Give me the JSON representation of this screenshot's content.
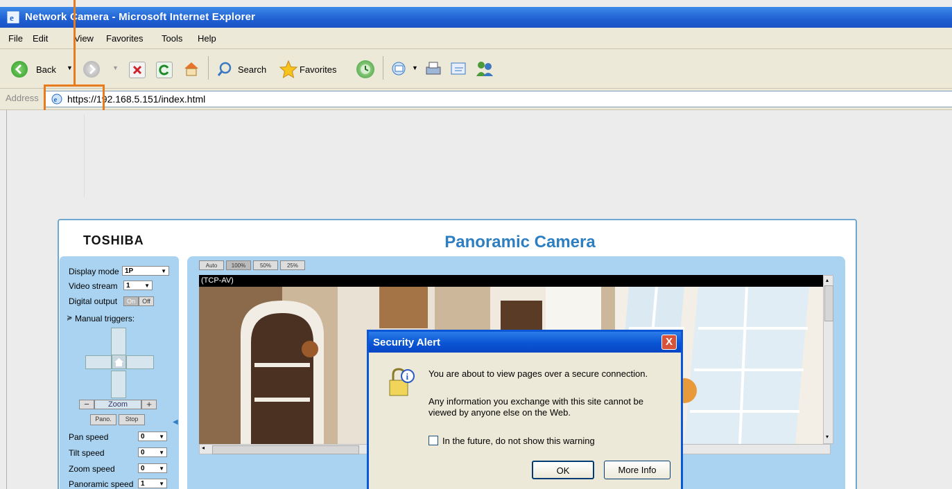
{
  "window": {
    "title": "Network Camera - Microsoft Internet Explorer"
  },
  "menu": [
    "File",
    "Edit",
    "View",
    "Favorites",
    "Tools",
    "Help"
  ],
  "toolbar": {
    "back": "Back",
    "search": "Search",
    "favorites": "Favorites"
  },
  "address": {
    "label": "Address",
    "url": "https://192.168.5.151/index.html"
  },
  "camera": {
    "brand": "TOSHIBA",
    "title": "Panoramic Camera",
    "display_mode": {
      "label": "Display mode",
      "value": "1P"
    },
    "video_stream": {
      "label": "Video stream",
      "value": "1"
    },
    "digital_output": {
      "label": "Digital output",
      "on": "On",
      "off": "Off"
    },
    "manual_triggers": "Manual triggers:",
    "zoom": {
      "minus": "−",
      "label": "Zoom",
      "plus": "+"
    },
    "pano_button": "Pano.",
    "stop_button": "Stop",
    "pan_speed": {
      "label": "Pan speed",
      "value": "0"
    },
    "tilt_speed": {
      "label": "Tilt speed",
      "value": "0"
    },
    "zoom_speed": {
      "label": "Zoom speed",
      "value": "0"
    },
    "panoramic_speed": {
      "label": "Panoramic speed",
      "value": "1"
    },
    "view_sizes": [
      "Auto",
      "100%",
      "50%",
      "25%"
    ],
    "video_header": "(TCP-AV)"
  },
  "dialog": {
    "title": "Security Alert",
    "message": "You are about to view pages over a secure connection.",
    "info_line1": "Any information you exchange with this site cannot be",
    "info_line2": "viewed by anyone else on the Web.",
    "checkbox_label": "In the future, do not show this warning",
    "ok": "OK",
    "more_info": "More Info",
    "close": "X"
  }
}
